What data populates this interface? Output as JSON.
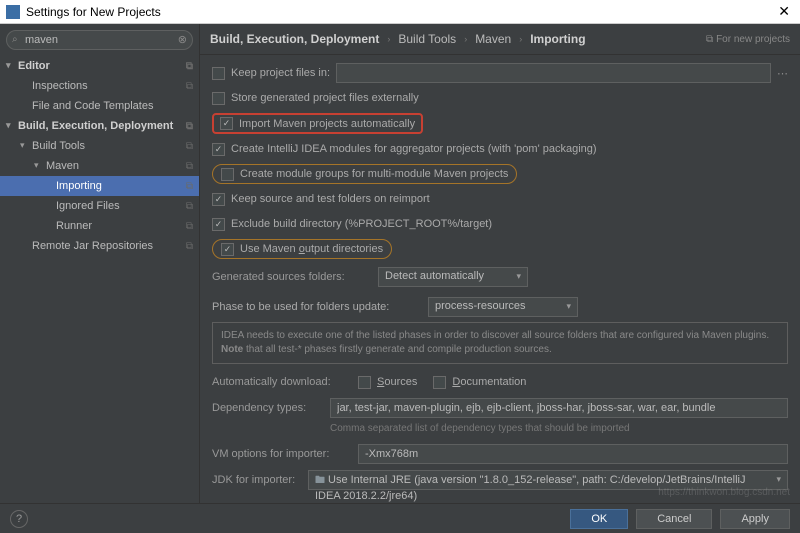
{
  "window": {
    "title": "Settings for New Projects",
    "close": "✕"
  },
  "search": {
    "value": "maven",
    "icon": "⌕",
    "clear": "⊗"
  },
  "sidebar": {
    "editor": {
      "label": "Editor",
      "inspections": "Inspections",
      "fileTemplates": "File and Code Templates"
    },
    "bed": {
      "label": "Build, Execution, Deployment",
      "buildTools": "Build Tools",
      "maven": "Maven",
      "importing": "Importing",
      "ignored": "Ignored Files",
      "runner": "Runner",
      "remote": "Remote Jar Repositories"
    }
  },
  "breadcrumb": {
    "a": "Build, Execution, Deployment",
    "b": "Build Tools",
    "c": "Maven",
    "d": "Importing",
    "badge": "For new projects"
  },
  "form": {
    "keepProjectFiles": "Keep project files in:",
    "storeGenerated": "Store generated project files externally",
    "importAuto": "Import Maven projects automatically",
    "createModules": "Create IntelliJ IDEA modules for aggregator projects (with 'pom' packaging)",
    "createGroups": "Create module groups for multi-module Maven projects",
    "keepSource": "Keep source and test folders on reimport",
    "excludeBuild": "Exclude build directory (%PROJECT_ROOT%/target)",
    "useOutput": "Use Maven output directories",
    "generatedLabel": "Generated sources folders:",
    "generatedValue": "Detect automatically",
    "phaseLabel": "Phase to be used for folders update:",
    "phaseValue": "process-resources",
    "note1": "IDEA needs to execute one of the listed phases in order to discover all source folders that are configured via Maven plugins.",
    "note2a": "Note",
    "note2b": " that all test-* phases firstly generate and compile production sources.",
    "autoDownload": "Automatically download:",
    "sources": "Sources",
    "documentation": "Documentation",
    "depTypesLabel": "Dependency types:",
    "depTypesValue": "jar, test-jar, maven-plugin, ejb, ejb-client, jboss-har, jboss-sar, war, ear, bundle",
    "depHint": "Comma separated list of dependency types that should be imported",
    "vmLabel": "VM options for importer:",
    "vmValue": "-Xmx768m",
    "jdkLabel": "JDK for importer:",
    "jdkValue": "Use Internal JRE (java version \"1.8.0_152-release\", path: C:/develop/JetBrains/IntelliJ IDEA 2018.2.2/jre64)"
  },
  "footer": {
    "ok": "OK",
    "cancel": "Cancel",
    "apply": "Apply"
  },
  "watermark": "https://thinkwon.blog.csdn.net"
}
